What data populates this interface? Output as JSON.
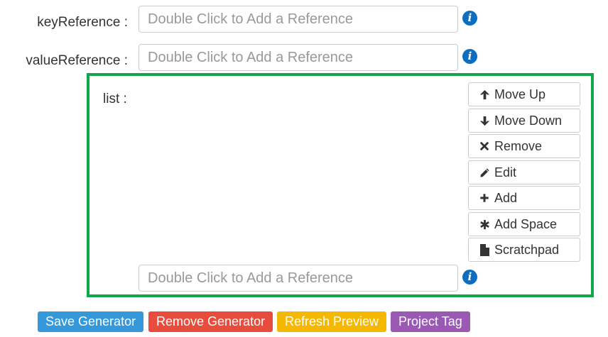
{
  "form": {
    "key_reference_label": "keyReference :",
    "value_reference_label": "valueReference :",
    "reference_placeholder": "Double Click to Add a Reference",
    "info_glyph": "i"
  },
  "list": {
    "label": "list :",
    "border_color": "#10a74a",
    "item_placeholder": "Double Click to Add a Reference",
    "buttons": [
      {
        "label": "Move Up",
        "icon": "arrow-up-icon"
      },
      {
        "label": "Move Down",
        "icon": "arrow-down-icon"
      },
      {
        "label": "Remove",
        "icon": "times-icon"
      },
      {
        "label": "Edit",
        "icon": "pencil-icon"
      },
      {
        "label": "Add",
        "icon": "plus-icon"
      },
      {
        "label": "Add Space",
        "icon": "asterisk-icon"
      },
      {
        "label": "Scratchpad",
        "icon": "file-icon"
      }
    ]
  },
  "actions": {
    "save": {
      "label": "Save Generator",
      "color": "#3498db"
    },
    "remove": {
      "label": "Remove Generator",
      "color": "#e74c3c"
    },
    "refresh": {
      "label": "Refresh Preview",
      "color": "#f5b800"
    },
    "tag": {
      "label": "Project Tag",
      "color": "#9b59b6"
    }
  }
}
